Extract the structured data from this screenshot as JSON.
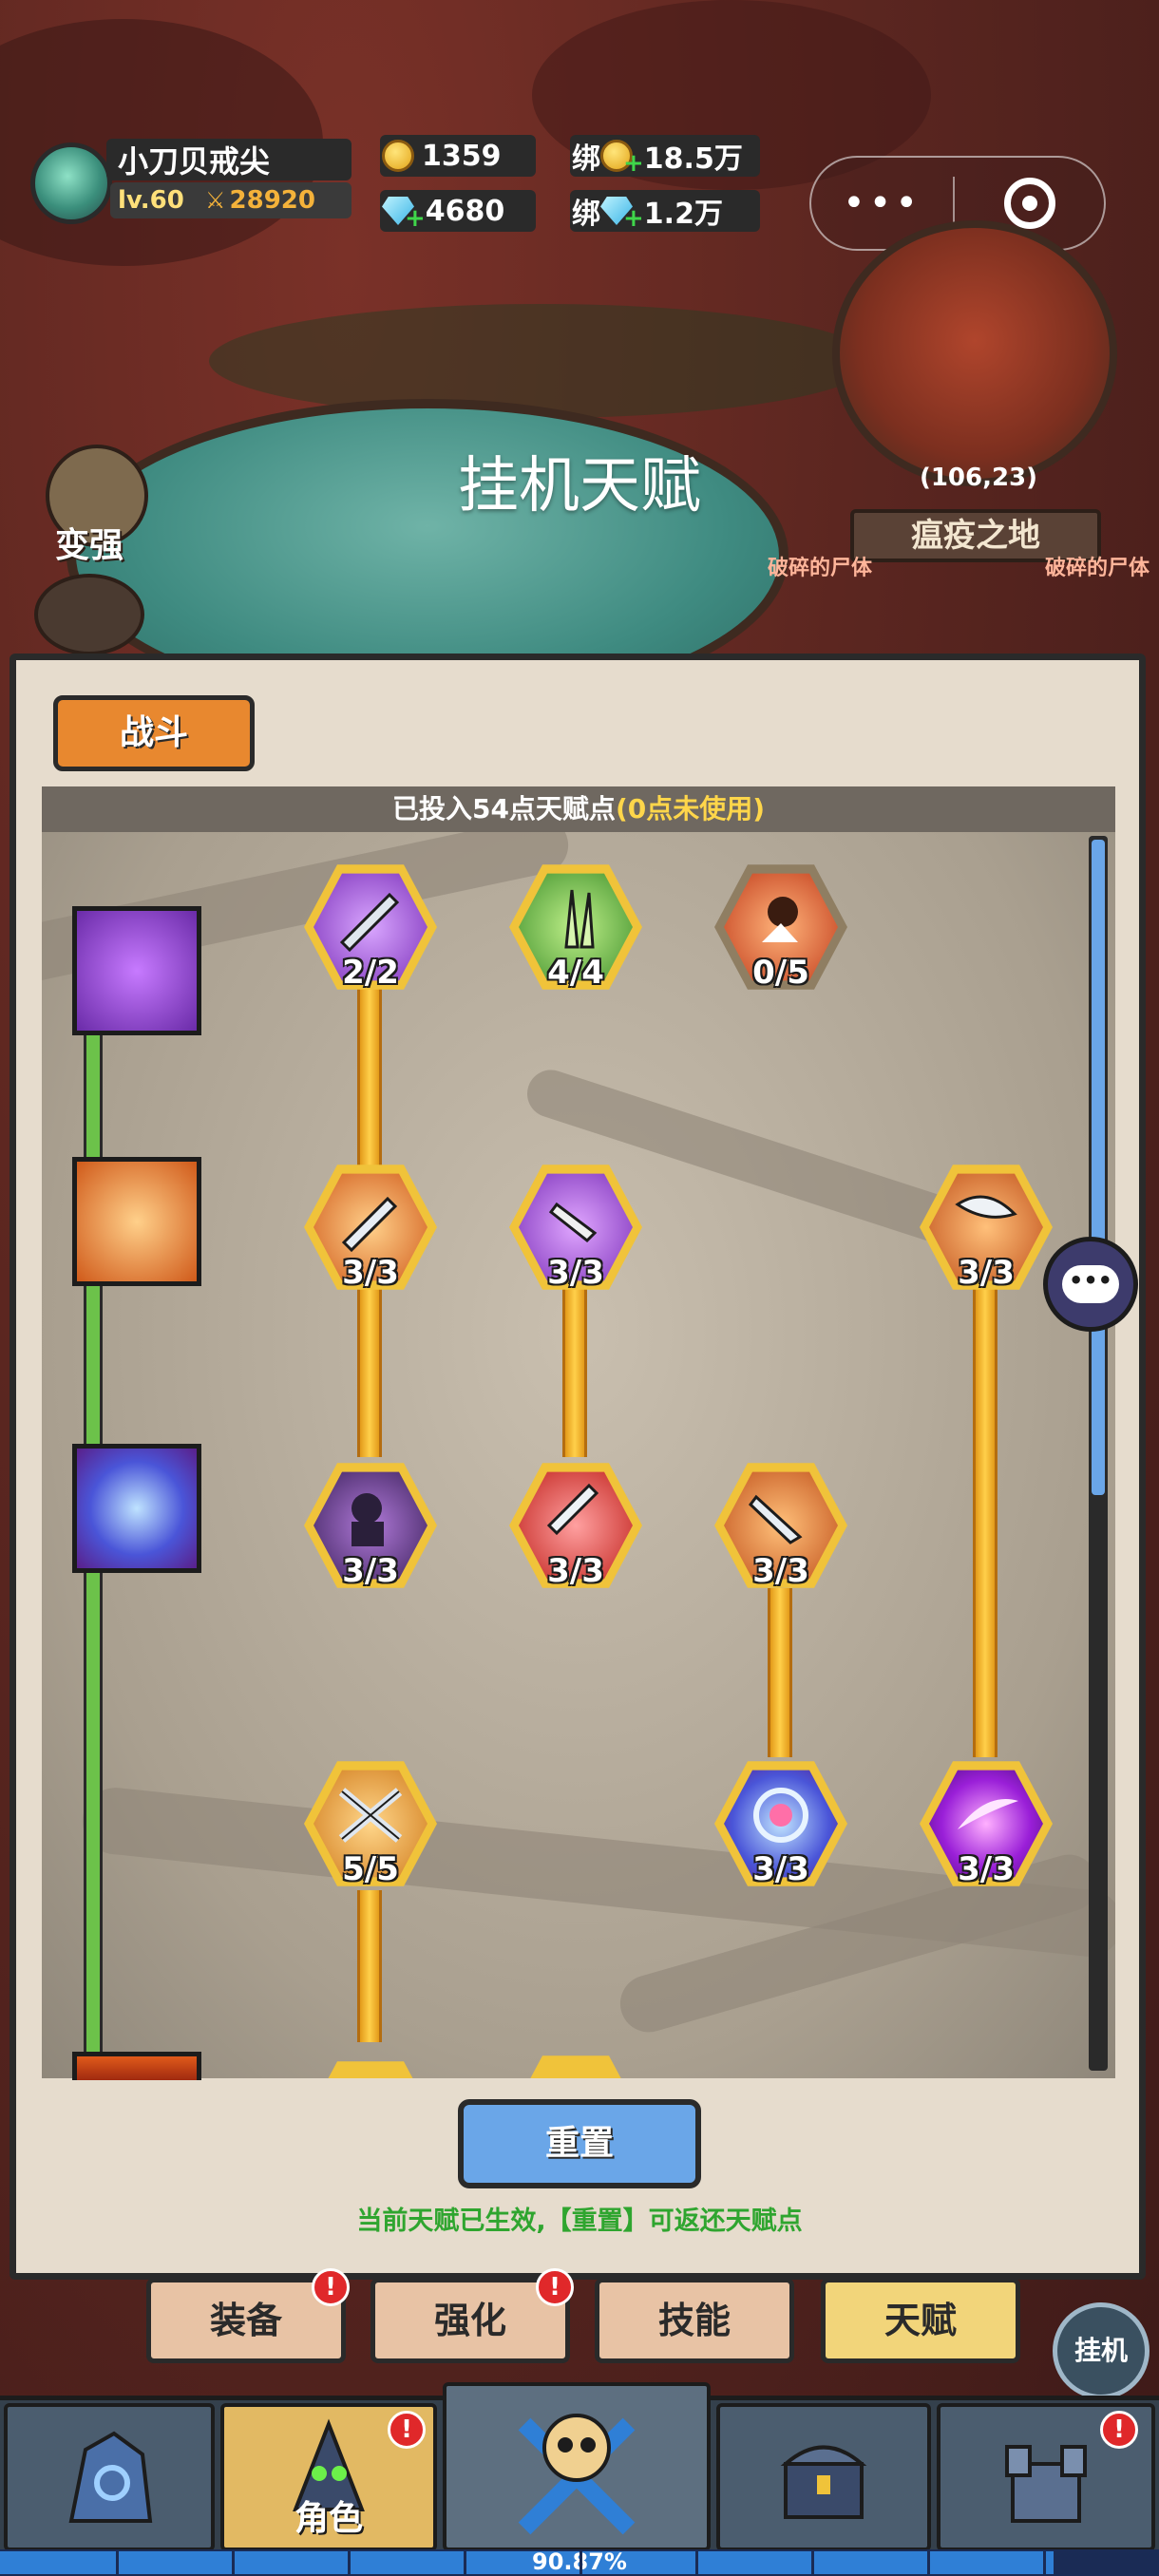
{
  "header": {
    "player_name": "小刀贝戒尖",
    "level": "lv.60",
    "power": "28920",
    "gold": "1359",
    "diamonds": "4680",
    "bound_gold_label": "绑",
    "bound_gold": "18.5万",
    "bound_diamond_label": "绑",
    "bound_diamond": "1.2万"
  },
  "capsule": {
    "more": "•••"
  },
  "map": {
    "coords": "(106,23)",
    "area": "瘟疫之地",
    "enemy_left": "破碎的尸体",
    "enemy_right": "破碎的尸体"
  },
  "page_title": "挂机天赋",
  "side": {
    "strengthen": "变强"
  },
  "panel": {
    "tab": "战斗",
    "points_prefix": "已投入54点天赋点",
    "points_unused": "(0点未使用)",
    "nodes": [
      {
        "label": "2/2",
        "icon": "purple-sword-icon"
      },
      {
        "label": "4/4",
        "icon": "green-blades-icon"
      },
      {
        "label": "0/5",
        "icon": "fire-fist-icon"
      },
      {
        "label": "3/3",
        "icon": "fire-sword-icon"
      },
      {
        "label": "3/3",
        "icon": "purple-dagger-icon"
      },
      {
        "label": "3/3",
        "icon": "fire-axe-icon"
      },
      {
        "label": "3/3",
        "icon": "ninja-icon"
      },
      {
        "label": "3/3",
        "icon": "red-dagger-icon"
      },
      {
        "label": "3/3",
        "icon": "fire-blade-icon"
      },
      {
        "label": "5/5",
        "icon": "crossed-swords-icon"
      },
      {
        "label": "3/3",
        "icon": "blue-vortex-icon"
      },
      {
        "label": "3/3",
        "icon": "purple-slash-icon"
      }
    ],
    "reset": "重置",
    "reset_hint": "当前天赋已生效,【重置】可返还天赋点"
  },
  "subtabs": [
    {
      "label": "装备",
      "badge": "!"
    },
    {
      "label": "强化",
      "badge": "!"
    },
    {
      "label": "技能",
      "badge": ""
    },
    {
      "label": "天赋",
      "badge": ""
    }
  ],
  "idle": "挂机",
  "bottom_nav": [
    {
      "label": "",
      "icon": "rock-portal-icon"
    },
    {
      "label": "角色",
      "icon": "hooded-character-icon",
      "badge": "!"
    },
    {
      "label": "",
      "icon": "skull-crossed-swords-icon"
    },
    {
      "label": "",
      "icon": "treasure-chest-icon"
    },
    {
      "label": "",
      "icon": "castle-icon",
      "badge": "!"
    }
  ],
  "progress": {
    "percent": 90.87,
    "label": "90.87%"
  },
  "colors": {
    "accent_orange": "#e8882f",
    "gold_node": "#f0c33a",
    "rail_green": "#6cc24a",
    "hint_green": "#2fa52f",
    "reset_blue": "#6aa6e8"
  }
}
